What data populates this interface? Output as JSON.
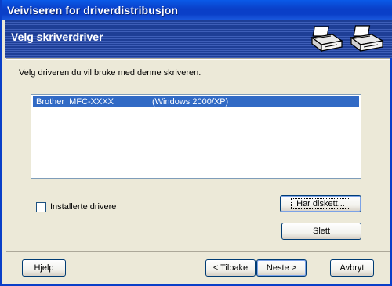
{
  "window": {
    "title": "Veiviseren for driverdistribusjon"
  },
  "banner": {
    "heading": "Velg skriverdriver",
    "icons": [
      "printer-icon",
      "printer-icon"
    ]
  },
  "main": {
    "instruction": "Velg driveren du vil bruke med denne skriveren.",
    "drivers": [
      {
        "name": "Brother  MFC-XXXX",
        "os": "(Windows 2000/XP)",
        "selected": true
      }
    ],
    "installed_drivers_checkbox": {
      "label": "Installerte drivere",
      "checked": false
    },
    "have_disk_button": "Har diskett...",
    "delete_button": "Slett"
  },
  "footer": {
    "help_button": "Hjelp",
    "back_button": "< Tilbake",
    "next_button": "Neste >",
    "cancel_button": "Avbryt"
  },
  "colors": {
    "titlebar": "#0A3FC8",
    "banner": "#1E3E96",
    "selection": "#316AC5",
    "dialog_bg": "#ECE9D8"
  }
}
